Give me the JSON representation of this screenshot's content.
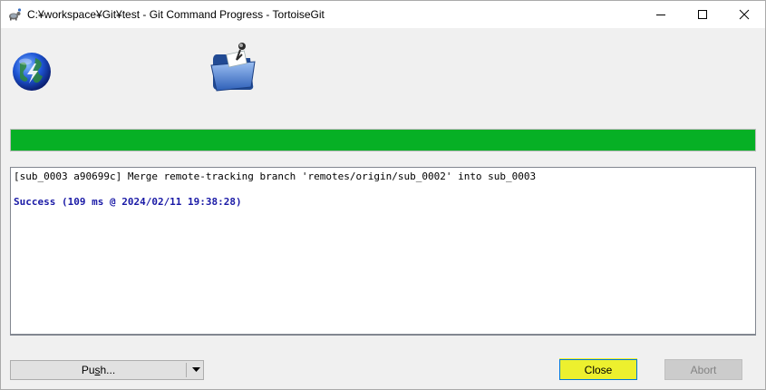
{
  "window": {
    "title": "C:¥workspace¥Git¥test - Git Command Progress - TortoiseGit"
  },
  "icons": {
    "app": "tortoisegit-icon",
    "globe": "globe-icon",
    "folder": "folder-icon",
    "minimize": "minimize-icon",
    "maximize": "maximize-icon",
    "close": "close-icon",
    "dropdown": "chevron-down-icon"
  },
  "progress": {
    "value": 1.0,
    "color": "#06b025"
  },
  "log": {
    "lines": [
      "[sub_0003 a90699c] Merge remote-tracking branch 'remotes/origin/sub_0002' into sub_0003"
    ],
    "status": "Success (109 ms @ 2024/02/11 19:38:28)",
    "status_color": "#1a1aa6"
  },
  "buttons": {
    "push_pre": "Pu",
    "push_underline": "s",
    "push_post": "h...",
    "close": "Close",
    "abort": "Abort"
  },
  "colors": {
    "highlight": "#ecf00c",
    "accent": "#0078d7"
  }
}
